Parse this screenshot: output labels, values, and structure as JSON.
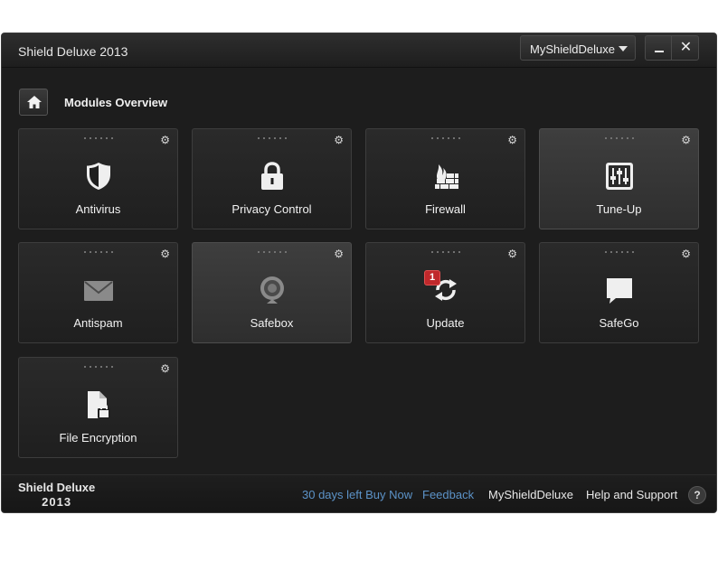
{
  "window": {
    "title": "Shield Deluxe 2013",
    "account_button": "MyShieldDeluxe",
    "close_glyph": "✕"
  },
  "page": {
    "section_title": "Modules Overview"
  },
  "tiles": [
    {
      "label": "Antivirus",
      "icon": "shield-icon"
    },
    {
      "label": "Privacy Control",
      "icon": "lock-icon"
    },
    {
      "label": "Firewall",
      "icon": "firewall-icon"
    },
    {
      "label": "Tune-Up",
      "icon": "sliders-icon"
    },
    {
      "label": "Antispam",
      "icon": "envelope-icon"
    },
    {
      "label": "Safebox",
      "icon": "webcam-icon"
    },
    {
      "label": "Update",
      "icon": "refresh-icon",
      "badge": "1"
    },
    {
      "label": "SafeGo",
      "icon": "chat-bubble-icon"
    },
    {
      "label": "File Encryption",
      "icon": "file-lock-icon"
    }
  ],
  "footer": {
    "brand_line1": "Shield Deluxe",
    "brand_line2": "2013",
    "days_left": "30 days left Buy Now",
    "feedback": "Feedback",
    "account": "MyShieldDeluxe",
    "help": "Help and Support",
    "help_glyph": "?"
  },
  "colors": {
    "background": "#1d1d1d",
    "link_blue": "#5c93c8",
    "badge_red": "#c0282b"
  }
}
